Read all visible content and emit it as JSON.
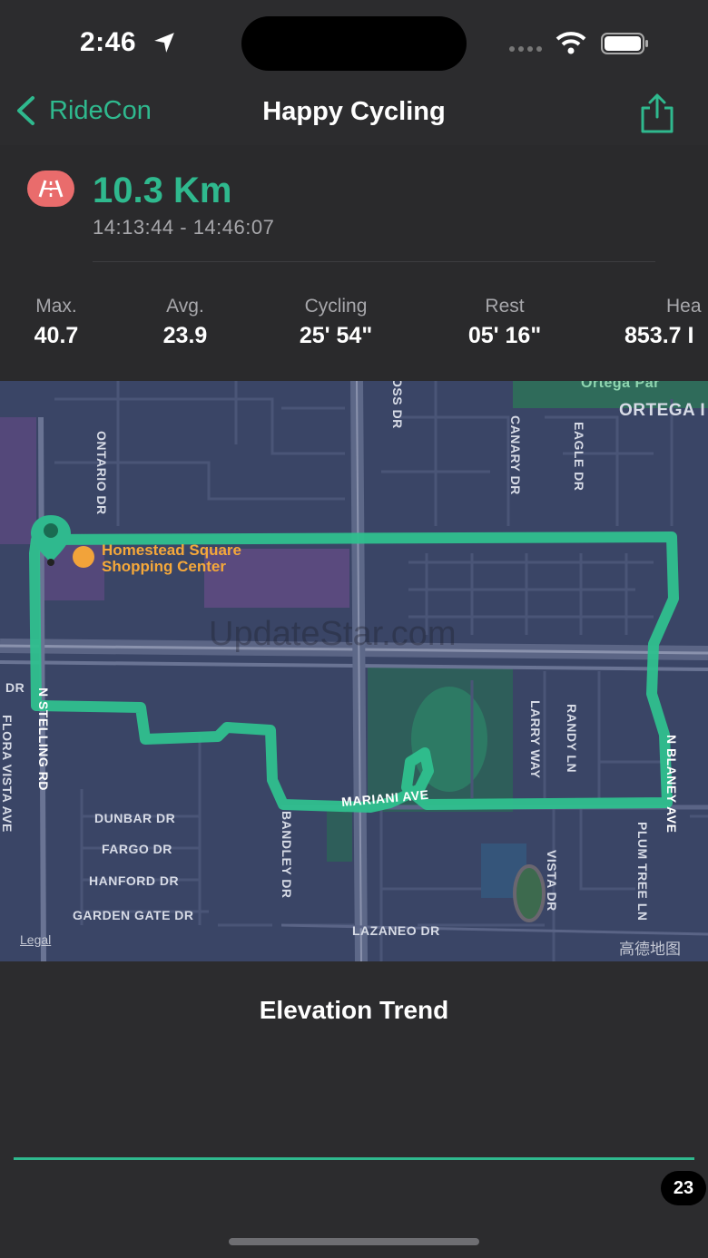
{
  "status": {
    "time": "2:46"
  },
  "nav": {
    "back_label": "RideCon",
    "title": "Happy Cycling"
  },
  "summary": {
    "distance": "10.3 Km",
    "time_range": "14:13:44 - 14:46:07"
  },
  "stats": [
    {
      "label": "Max.",
      "value": "40.7"
    },
    {
      "label": "Avg.",
      "value": "23.9"
    },
    {
      "label": "Cycling",
      "value": "25' 54\""
    },
    {
      "label": "Rest",
      "value": "05' 16\""
    },
    {
      "label": "Hea",
      "value": "853.7 I"
    }
  ],
  "map": {
    "poi": [
      "Homestead Square",
      "Shopping Center"
    ],
    "streets": {
      "ortega": "ORTEGA I",
      "ortega_park": "Ortega Par",
      "ontario": "ONTARIO DR",
      "canary": "CANARY DR",
      "eagle": "EAGLE DR",
      "oss": "OSS DR",
      "stelling": "N STELLING RD",
      "flora": "FLORA VISTA AVE",
      "dr": "DR",
      "larry": "LARRY WAY",
      "randy": "RANDY LN",
      "blaney": "N BLANEY AVE",
      "mariani": "MARIANI AVE",
      "dunbar": "DUNBAR DR",
      "fargo": "FARGO DR",
      "hanford": "HANFORD DR",
      "garden_gate": "GARDEN GATE DR",
      "bandley": "BANDLEY DR",
      "lazaneo": "LAZANEO DR",
      "vista": "VISTA DR",
      "plum_tree": "PLUM TREE LN"
    },
    "watermark": "UpdateStar.com",
    "legal": "Legal",
    "provider": "高德地图"
  },
  "elevation": {
    "title": "Elevation Trend",
    "badge": "23"
  },
  "colors": {
    "accent": "#2fb98e",
    "badge": "#e96c6c",
    "map_bg": "#3a4566",
    "route": "#2fc08e"
  },
  "icons": [
    "chevron-left-icon",
    "share-icon",
    "location-arrow-icon",
    "wifi-icon",
    "battery-icon",
    "road-icon",
    "map-pin-icon",
    "shopping-icon"
  ]
}
